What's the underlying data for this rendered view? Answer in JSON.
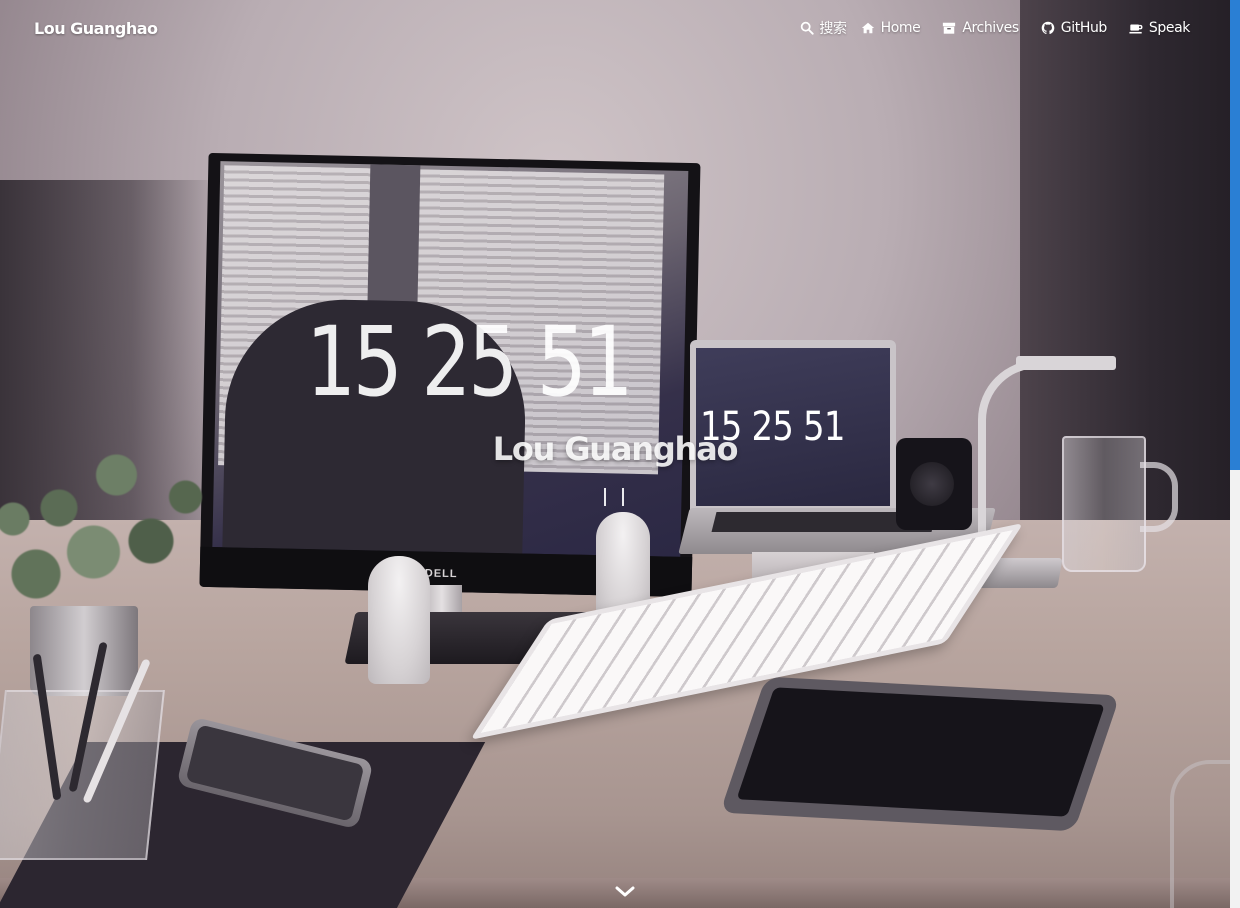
{
  "navbar": {
    "brand": "Lou Guanghao",
    "search_label": "搜索",
    "items": [
      {
        "label": "Home",
        "icon": "home-icon"
      },
      {
        "label": "Archives",
        "icon": "archive-icon"
      },
      {
        "label": "GitHub",
        "icon": "github-icon"
      },
      {
        "label": "Speak",
        "icon": "coffee-icon"
      }
    ]
  },
  "hero": {
    "title": "Lou Guanghao",
    "monitor_clock": "15 25 51",
    "laptop_clock": "15 25 51"
  },
  "colors": {
    "scrollbar_thumb": "#2a7fd4",
    "nav_text": "#ffffff"
  }
}
